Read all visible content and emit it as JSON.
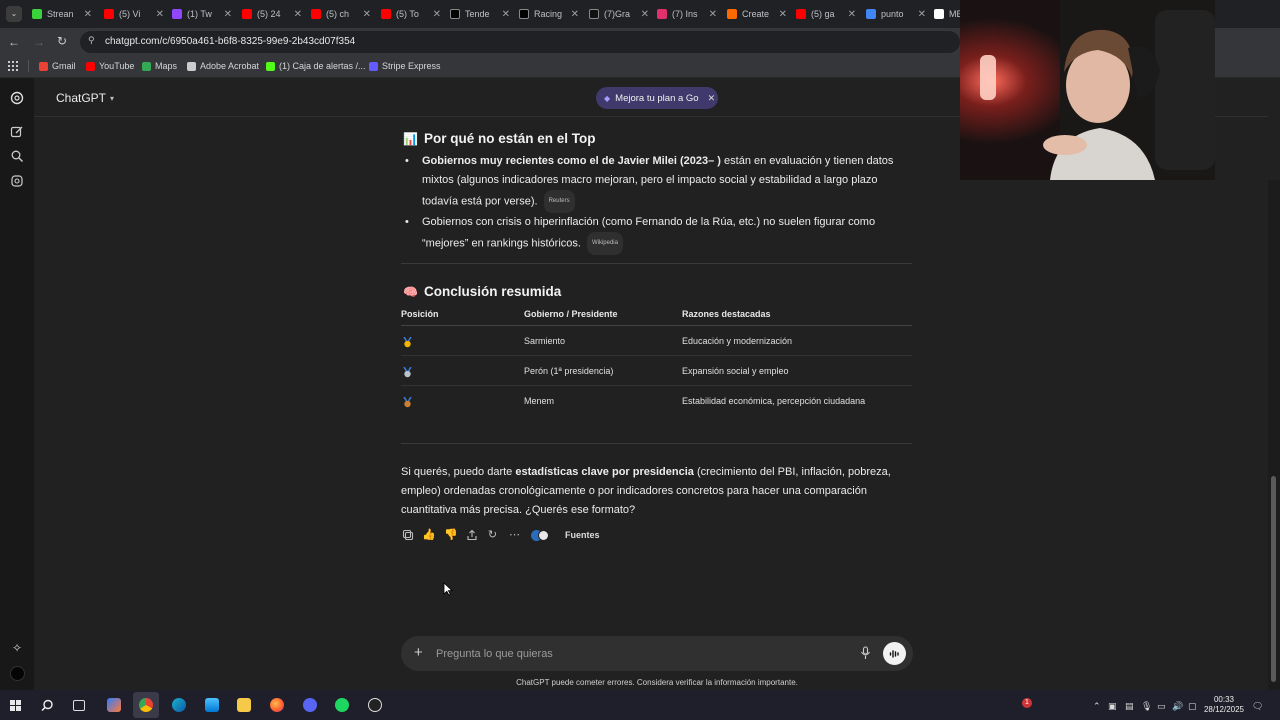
{
  "browser": {
    "tabs": [
      {
        "label": "Strean",
        "color": "#3bd33b"
      },
      {
        "label": "(5) Vi",
        "color": "#ff0000"
      },
      {
        "label": "(1) Tw",
        "color": "#9146ff"
      },
      {
        "label": "(5) 24",
        "color": "#ff0000"
      },
      {
        "label": "(5) ch",
        "color": "#ff0000"
      },
      {
        "label": "(5) To",
        "color": "#ff0000"
      },
      {
        "label": "Tende",
        "color": "#000000"
      },
      {
        "label": "Racing",
        "color": "#000000"
      },
      {
        "label": "(7)Gra",
        "color": "#111111"
      },
      {
        "label": "(7) Ins",
        "color": "#e1306c"
      },
      {
        "label": "Create",
        "color": "#ff6a00"
      },
      {
        "label": "(5) ga",
        "color": "#ff0000"
      },
      {
        "label": "punto",
        "color": "#4285f4"
      },
      {
        "label": "ME",
        "color": "#ffffff"
      }
    ],
    "url": "chatgpt.com/c/6950a461-b6f8-8325-99e9-2b43cd07f354",
    "bookmarks": [
      {
        "label": "Gmail",
        "color": "#ea4335"
      },
      {
        "label": "YouTube",
        "color": "#ff0000"
      },
      {
        "label": "Maps",
        "color": "#34a853"
      },
      {
        "label": "Adobe Acrobat",
        "color": "#cccccc"
      },
      {
        "label": "(1) Caja de alertas /...",
        "color": "#53fc18"
      },
      {
        "label": "Stripe Express",
        "color": "#635bff"
      }
    ]
  },
  "app": {
    "title": "ChatGPT",
    "upgrade_label": "Mejora tu plan a Go",
    "section1": {
      "emoji": "📊",
      "heading": "Por qué no están en el Top",
      "bullets": [
        {
          "bold": "Gobiernos muy recientes como el de Javier Milei (2023– )",
          "text": " están en evaluación y tienen datos mixtos (algunos indicadores macro mejoran, pero el impacto social y estabilidad a largo plazo todavía está por verse).",
          "cite": "Reuters"
        },
        {
          "bold": "",
          "text": "Gobiernos con crisis o hiperinflación (como Fernando de la Rúa, etc.) no suelen figurar como “mejores” en rankings históricos.",
          "cite": "Wikipedia"
        }
      ]
    },
    "section2": {
      "emoji": "🧠",
      "heading": "Conclusión resumida",
      "columns": [
        "Posición",
        "Gobierno / Presidente",
        "Razones destacadas"
      ],
      "rows": [
        {
          "medal_color": "#f5b400",
          "gov": "Sarmiento",
          "reason": "Educación y modernización"
        },
        {
          "medal_color": "#b8c4cc",
          "gov": "Perón (1ª presidencia)",
          "reason": "Expansión social y empleo"
        },
        {
          "medal_color": "#cd7f32",
          "gov": "Menem",
          "reason": "Estabilidad económica, percepción ciudadana"
        }
      ]
    },
    "closing": {
      "prefix": "Si querés, puedo darte ",
      "bold": "estadísticas clave por presidencia",
      "suffix": " (crecimiento del PBI, inflación, pobreza, empleo) ordenadas cronológicamente o por indicadores concretos para hacer una comparación cuantitativa más precisa. ¿Querés ese formato?"
    },
    "sources_label": "Fuentes",
    "composer_placeholder": "Pregunta lo que quieras",
    "disclaimer": "ChatGPT puede cometer errores. Considera verificar la información importante."
  },
  "taskbar": {
    "time": "00:33",
    "date": "28/12/2025",
    "badge": "1"
  }
}
